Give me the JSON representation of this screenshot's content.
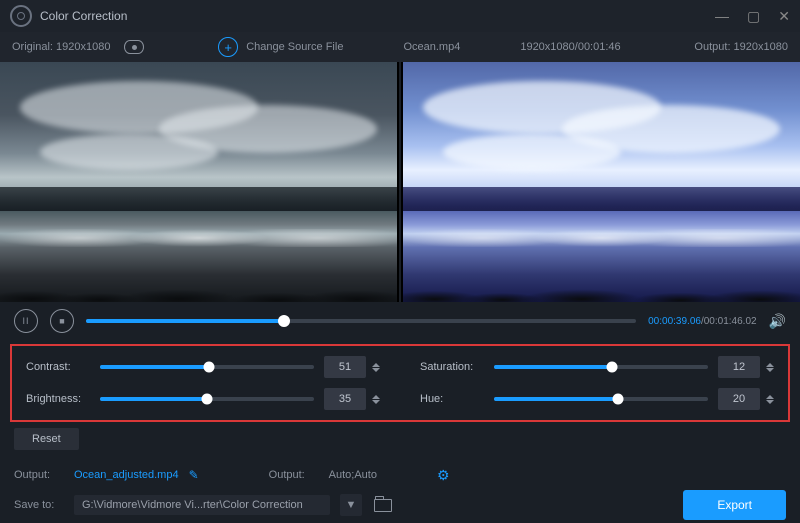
{
  "window": {
    "title": "Color Correction"
  },
  "infobar": {
    "original_label": "Original: 1920x1080",
    "change_source": "Change Source File",
    "filename": "Ocean.mp4",
    "resolution_duration": "1920x1080/00:01:46",
    "output_label": "Output: 1920x1080"
  },
  "playback": {
    "progress_pct": 36,
    "current_time": "00:00:39.06",
    "total_time": "00:01:46.02"
  },
  "controls": {
    "contrast": {
      "label": "Contrast:",
      "value": 51,
      "max": 100
    },
    "saturation": {
      "label": "Saturation:",
      "value": 12,
      "max": 100
    },
    "brightness": {
      "label": "Brightness:",
      "value": 35,
      "max": 100
    },
    "hue": {
      "label": "Hue:",
      "value": 20,
      "max": 100
    },
    "contrast_pct": 51,
    "saturation_pct": 55,
    "brightness_pct": 50,
    "hue_pct": 58,
    "reset": "Reset"
  },
  "output": {
    "file_label": "Output:",
    "filename": "Ocean_adjusted.mp4",
    "settings_label": "Output:",
    "settings_value": "Auto;Auto",
    "save_label": "Save to:",
    "save_path": "G:\\Vidmore\\Vidmore Vi...rter\\Color Correction",
    "export": "Export"
  }
}
